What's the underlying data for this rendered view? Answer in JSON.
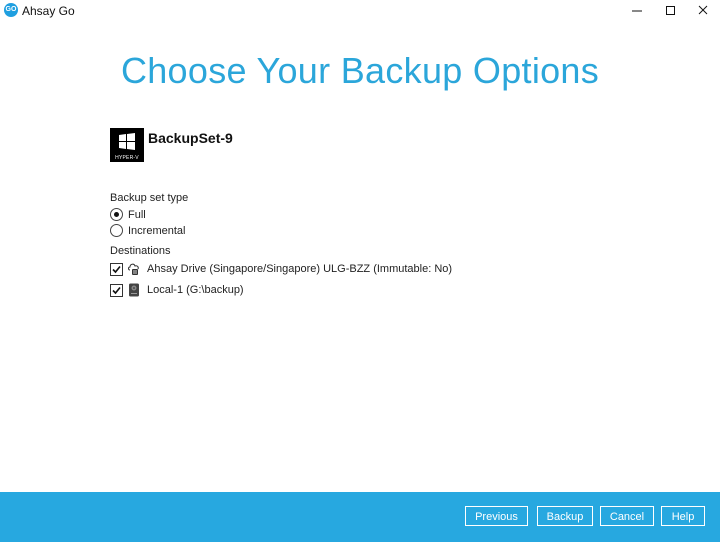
{
  "window": {
    "title": "Ahsay Go",
    "logo_text": "GO"
  },
  "page": {
    "heading": "Choose Your Backup Options"
  },
  "backup_set": {
    "name": "BackupSet-9",
    "icon_label": "HYPER-V"
  },
  "backup_type": {
    "label": "Backup set type",
    "options": [
      {
        "label": "Full",
        "selected": true
      },
      {
        "label": "Incremental",
        "selected": false
      }
    ]
  },
  "destinations": {
    "label": "Destinations",
    "items": [
      {
        "label": "Ahsay Drive (Singapore/Singapore) ULG-BZZ (Immutable: No)",
        "checked": true,
        "icon": "cloud-drive-icon"
      },
      {
        "label": "Local-1 (G:\\backup)",
        "checked": true,
        "icon": "local-drive-icon"
      }
    ]
  },
  "footer": {
    "previous": "Previous",
    "backup": "Backup",
    "cancel": "Cancel",
    "help": "Help"
  },
  "colors": {
    "accent": "#2ba6da",
    "footer": "#27a8e0"
  }
}
